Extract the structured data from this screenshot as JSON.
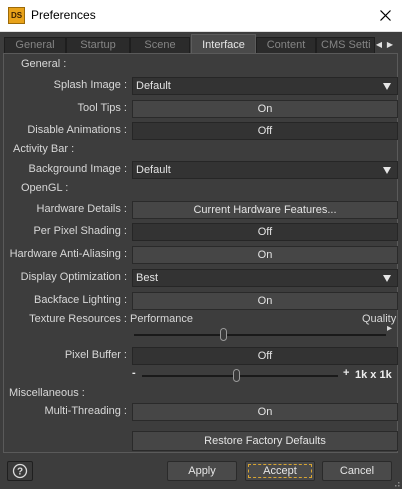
{
  "window": {
    "app_icon_text": "DS",
    "title": "Preferences"
  },
  "tabs": [
    {
      "label": "General"
    },
    {
      "label": "Startup"
    },
    {
      "label": "Scene"
    },
    {
      "label": "Interface",
      "active": true
    },
    {
      "label": "Content"
    },
    {
      "label": "CMS Setti"
    }
  ],
  "general": {
    "heading": "General :",
    "splash_image": {
      "label": "Splash Image :",
      "value": "Default"
    },
    "tool_tips": {
      "label": "Tool Tips :",
      "value": "On"
    },
    "disable_animations": {
      "label": "Disable Animations :",
      "value": "Off"
    }
  },
  "activity_bar": {
    "heading": "Activity Bar :",
    "background_image": {
      "label": "Background Image :",
      "value": "Default"
    }
  },
  "opengl": {
    "heading": "OpenGL :",
    "hardware_details": {
      "label": "Hardware Details :",
      "value": "Current Hardware Features..."
    },
    "per_pixel_shading": {
      "label": "Per Pixel Shading :",
      "value": "Off"
    },
    "hardware_anti_aliasing": {
      "label": "Hardware Anti-Aliasing :",
      "value": "On"
    },
    "display_optimization": {
      "label": "Display Optimization :",
      "value": "Best"
    },
    "backface_lighting": {
      "label": "Backface Lighting :",
      "value": "On"
    },
    "texture_resources": {
      "label": "Texture Resources :",
      "min_label": "Performance",
      "max_label": "Quality",
      "level": 0.35
    },
    "pixel_buffer": {
      "label": "Pixel Buffer :",
      "value": "Off",
      "minus": "-",
      "plus": "+",
      "size_label": "1k x 1k",
      "level": 0.48
    }
  },
  "misc": {
    "heading": "Miscellaneous :",
    "multi_threading": {
      "label": "Multi-Threading :",
      "value": "On"
    },
    "restore_defaults": "Restore Factory Defaults"
  },
  "footer": {
    "apply": "Apply",
    "accept": "Accept",
    "cancel": "Cancel"
  }
}
